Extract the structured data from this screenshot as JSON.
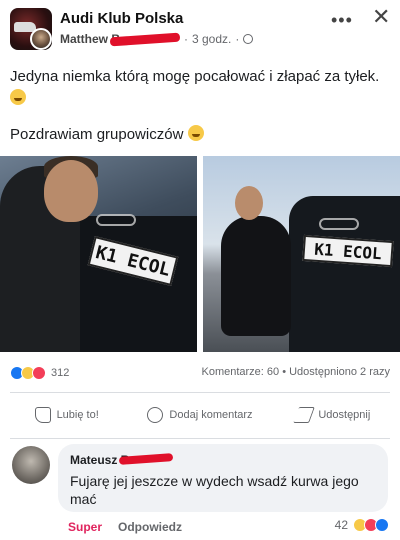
{
  "header": {
    "group_name": "Audi Klub Polska",
    "author": "Matthew B",
    "time": "3 godz.",
    "separator": "·",
    "more_icon": "more-dots-icon",
    "close_icon": "close-icon",
    "privacy_icon": "globe-icon"
  },
  "post": {
    "text": "Jedyna niemka którą mogę pocałować i złapać za tyłek.",
    "greeting": "Pozdrawiam grupowiczów",
    "photos": [
      {
        "plate": "K1 ECOL"
      },
      {
        "plate": "K1 ECOL"
      }
    ]
  },
  "stats": {
    "reaction_count": "312",
    "comments_shares": "Komentarze: 60 • Udostępniono 2 razy",
    "reaction_types": [
      "like",
      "haha",
      "love"
    ],
    "colors": {
      "like": "#1877f2",
      "haha": "#f7c948",
      "love": "#f33e58"
    }
  },
  "actions": {
    "like": "Lubię to!",
    "comment": "Dodaj komentarz",
    "share": "Udostępnij"
  },
  "comment": {
    "author": "Mateusz R",
    "text": "Fujarę jej jeszcze w wydech wsadź kurwa jego mać",
    "reaction_label": "Super",
    "reply_label": "Odpowiedz",
    "reaction_count": "42"
  }
}
